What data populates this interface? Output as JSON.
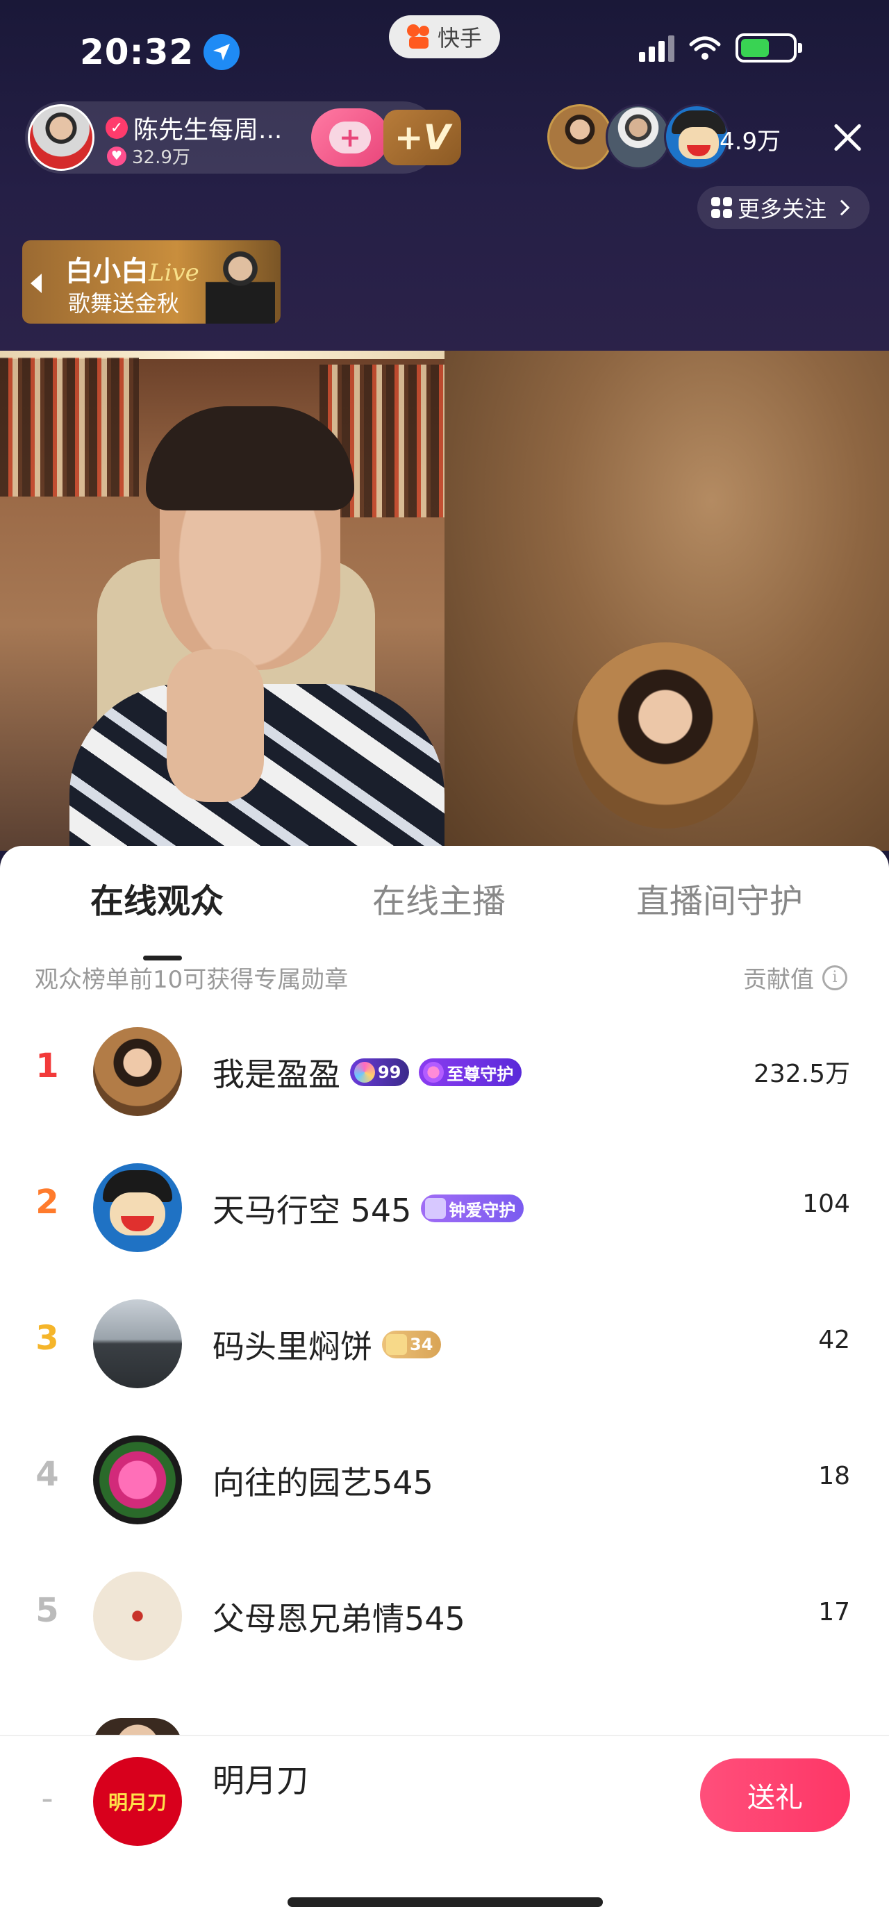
{
  "status_bar": {
    "time": "20:32",
    "app_pill": "快手"
  },
  "host": {
    "name": "陈先生每周...",
    "likes": "32.9万",
    "follow_symbol": "+",
    "plus_v_label": "+V"
  },
  "viewers": {
    "count": "4.9万"
  },
  "more_follow": {
    "label": "更多关注"
  },
  "promo": {
    "title": "白小白",
    "title_script": "Live",
    "subtitle": "歌舞送金秋"
  },
  "tabs": [
    {
      "label": "在线观众",
      "active": true
    },
    {
      "label": "在线主播",
      "active": false
    },
    {
      "label": "直播间守护",
      "active": false
    }
  ],
  "hint_text": "观众榜单前10可获得专属勋章",
  "contrib_header": "贡献值",
  "ranking": [
    {
      "rank": "1",
      "rank_color": "#f23a3a",
      "name": "我是盈盈",
      "badges": [
        {
          "type": "level",
          "text": "99"
        },
        {
          "type": "supreme",
          "text": "至尊守护"
        }
      ],
      "score": "232.5万"
    },
    {
      "rank": "2",
      "rank_color": "#ff7b2c",
      "name": "天马行空 545",
      "badges": [
        {
          "type": "fond",
          "text": "钟爱守护"
        }
      ],
      "score": "104"
    },
    {
      "rank": "3",
      "rank_color": "#f5b52a",
      "name": "码头里焖饼",
      "badges": [
        {
          "type": "box",
          "text": "34"
        }
      ],
      "score": "42"
    },
    {
      "rank": "4",
      "rank_color": "#bbbbbb",
      "name": "向往的园艺545",
      "badges": [],
      "score": "18"
    },
    {
      "rank": "5",
      "rank_color": "#bbbbbb",
      "name": "父母恩兄弟情545",
      "badges": [],
      "score": "17"
    }
  ],
  "me": {
    "rank": "-",
    "name": "明月刀",
    "avatar_text": "明月刀",
    "gift_button": "送礼"
  },
  "colors": {
    "accent": "#fe3666",
    "sheet_bg": "#ffffff",
    "top_bg": "#1d1a3a"
  }
}
